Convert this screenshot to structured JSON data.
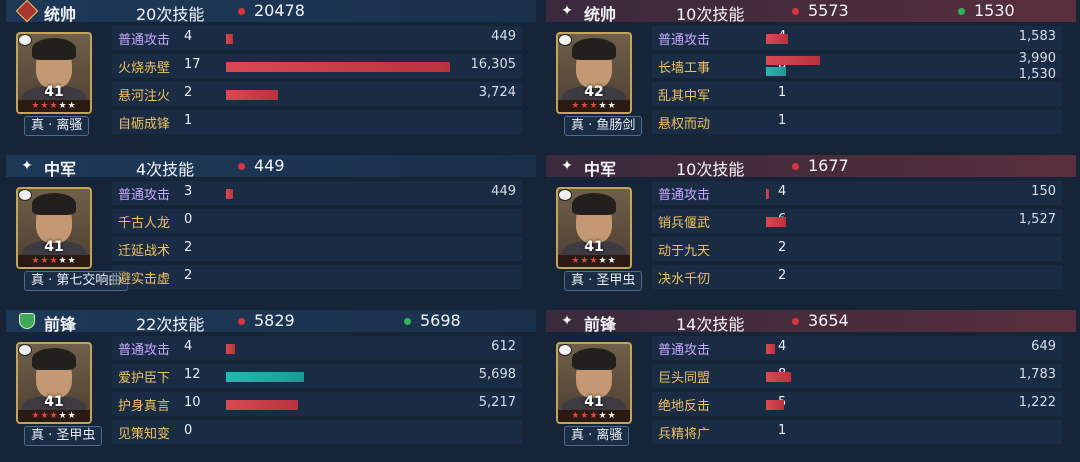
{
  "colors": {
    "damage_dot": "#d8353d",
    "heal_dot": "#2fb45a",
    "damage_bar": "#d84a52",
    "heal_bar": "#28b6b0",
    "skill_name": "#f0c060",
    "basic_attack": "#c9a6ff"
  },
  "left": [
    {
      "role": "统帅",
      "role_icon": "diamond-icon",
      "casts": "20次技能",
      "damage": "20478",
      "heal": "",
      "level": "41",
      "tag": "真 · 离骚",
      "skills": [
        {
          "name": "普通攻击",
          "count": "4",
          "value": "449",
          "dmg_ratio": 0.03
        },
        {
          "name": "火烧赤壁",
          "count": "17",
          "value": "16,305",
          "dmg_ratio": 1.0
        },
        {
          "name": "悬河注火",
          "count": "2",
          "value": "3,724",
          "dmg_ratio": 0.23
        },
        {
          "name": "自砺成锋",
          "count": "1",
          "value": ""
        }
      ]
    },
    {
      "role": "中军",
      "role_icon": "spark-icon",
      "casts": "4次技能",
      "damage": "449",
      "heal": "",
      "level": "41",
      "tag": "真 · 第七交响曲",
      "skills": [
        {
          "name": "普通攻击",
          "count": "3",
          "value": "449",
          "dmg_ratio": 0.03
        },
        {
          "name": "千古人龙",
          "count": "0",
          "value": ""
        },
        {
          "name": "迁延战术",
          "count": "2",
          "value": ""
        },
        {
          "name": "避实击虚",
          "count": "2",
          "value": ""
        }
      ]
    },
    {
      "role": "前锋",
      "role_icon": "shield-icon",
      "casts": "22次技能",
      "damage": "5829",
      "heal": "5698",
      "level": "41",
      "tag": "真 · 圣甲虫",
      "skills": [
        {
          "name": "普通攻击",
          "count": "4",
          "value": "612",
          "dmg_ratio": 0.04
        },
        {
          "name": "爱护臣下",
          "count": "12",
          "value": "5,698",
          "heal_ratio": 0.35
        },
        {
          "name": "护身真言",
          "count": "10",
          "value": "5,217",
          "dmg_ratio": 0.32
        },
        {
          "name": "见策知变",
          "count": "0",
          "value": ""
        }
      ]
    }
  ],
  "right": [
    {
      "role": "统帅",
      "role_icon": "spark-icon",
      "casts": "10次技能",
      "damage": "5573",
      "heal": "1530",
      "level": "42",
      "tag": "真 · 鱼肠剑",
      "skills": [
        {
          "name": "普通攻击",
          "count": "4",
          "value": "1,583",
          "dmg_ratio": 0.1
        },
        {
          "name": "长墙工事",
          "count": "8",
          "value": "3,990",
          "value2": "1,530",
          "dmg_ratio": 0.24,
          "heal_ratio": 0.09
        },
        {
          "name": "乱其中军",
          "count": "1",
          "value": ""
        },
        {
          "name": "悬权而动",
          "count": "1",
          "value": ""
        }
      ]
    },
    {
      "role": "中军",
      "role_icon": "spark-icon",
      "casts": "10次技能",
      "damage": "1677",
      "heal": "",
      "level": "41",
      "tag": "真 · 圣甲虫",
      "skills": [
        {
          "name": "普通攻击",
          "count": "4",
          "value": "150",
          "dmg_ratio": 0.01
        },
        {
          "name": "销兵偃武",
          "count": "6",
          "value": "1,527",
          "dmg_ratio": 0.09
        },
        {
          "name": "动于九天",
          "count": "2",
          "value": ""
        },
        {
          "name": "决水千仞",
          "count": "2",
          "value": ""
        }
      ]
    },
    {
      "role": "前锋",
      "role_icon": "spark-icon",
      "casts": "14次技能",
      "damage": "3654",
      "heal": "",
      "level": "41",
      "tag": "真 · 离骚",
      "skills": [
        {
          "name": "普通攻击",
          "count": "4",
          "value": "649",
          "dmg_ratio": 0.04
        },
        {
          "name": "巨头同盟",
          "count": "8",
          "value": "1,783",
          "dmg_ratio": 0.11
        },
        {
          "name": "绝地反击",
          "count": "5",
          "value": "1,222",
          "dmg_ratio": 0.08
        },
        {
          "name": "兵精将广",
          "count": "1",
          "value": ""
        }
      ]
    }
  ]
}
